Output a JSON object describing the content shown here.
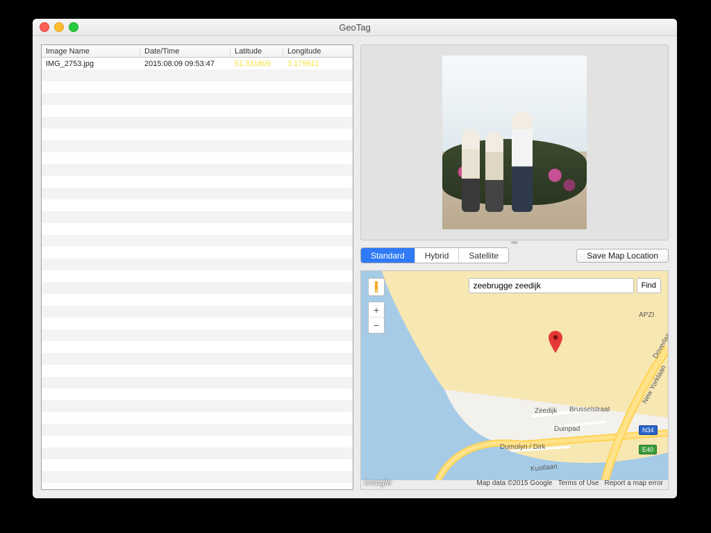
{
  "window": {
    "title": "GeoTag"
  },
  "table": {
    "columns": [
      "Image Name",
      "Date/Time",
      "Latitude",
      "Longitude"
    ],
    "rows": [
      {
        "name": "IMG_2753.jpg",
        "date": "2015:08:09 09:53:47",
        "lat": "51.331809",
        "lon": "3.179811"
      }
    ]
  },
  "map_types": {
    "options": [
      "Standard",
      "Hybrid",
      "Satellite"
    ],
    "active": 0
  },
  "save_map_label": "Save Map Location",
  "map": {
    "search_value": "zeebrugge zeedijk",
    "find_label": "Find",
    "zoom_in": "+",
    "zoom_out": "−",
    "logo": "Google",
    "attribution": "Map data ©2015 Google",
    "terms": "Terms of Use",
    "report": "Report a map error",
    "labels": {
      "zeedijk": "Zeedijk",
      "brusselstraat": "Brusselstraat",
      "duinpad": "Duinpad",
      "dumolyn": "Dumolyn / Dirk",
      "kustlaan": "Kustlaan",
      "newyorklaan": "New Yorklaan",
      "doverlaan": "Doverlaan",
      "apzi": "APZI"
    },
    "badges": {
      "n34": "N34",
      "e40": "E40"
    }
  }
}
